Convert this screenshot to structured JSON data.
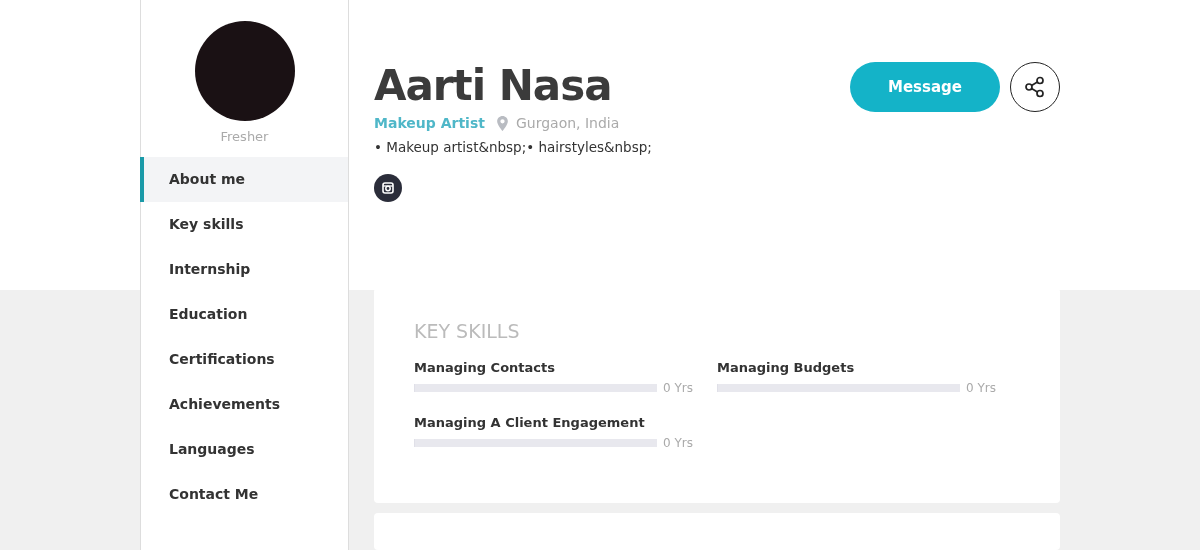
{
  "profile": {
    "status": "Fresher",
    "name": "Aarti Nasa",
    "role": "Makeup Artist",
    "location": "Gurgaon, India",
    "summary": "• Makeup artist&nbsp;• hairstyles&nbsp;"
  },
  "actions": {
    "message": "Message"
  },
  "sidebar": {
    "items": [
      {
        "label": "About me",
        "selected": true
      },
      {
        "label": "Key skills",
        "selected": false
      },
      {
        "label": "Internship",
        "selected": false
      },
      {
        "label": "Education",
        "selected": false
      },
      {
        "label": "Certifications",
        "selected": false
      },
      {
        "label": "Achievements",
        "selected": false
      },
      {
        "label": "Languages",
        "selected": false
      },
      {
        "label": "Contact Me",
        "selected": false
      }
    ]
  },
  "key_skills": {
    "title": "KEY SKILLS",
    "skills": [
      {
        "name": "Managing Contacts",
        "level": 0,
        "reading": "0 Yrs"
      },
      {
        "name": "Managing Budgets",
        "level": 0,
        "reading": "0 Yrs"
      },
      {
        "name": "Managing A Client Engagement",
        "level": 0,
        "reading": "0 Yrs"
      }
    ]
  }
}
